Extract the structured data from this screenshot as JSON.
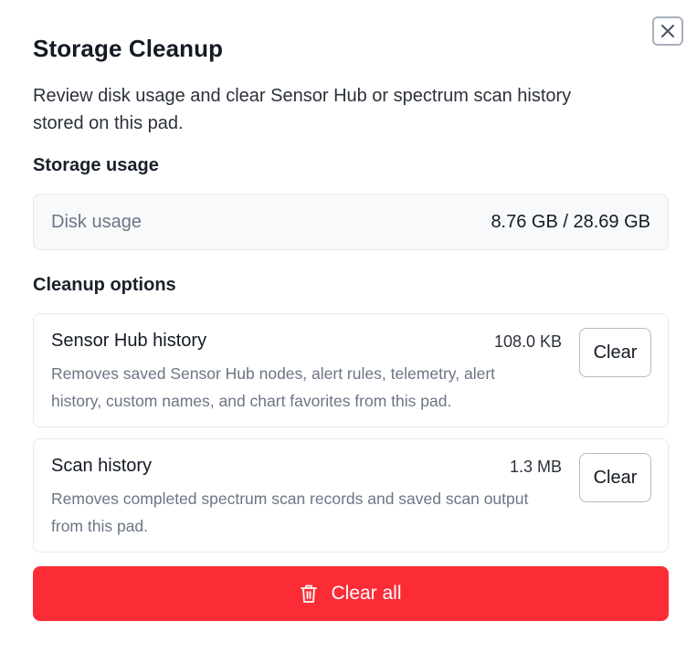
{
  "dialog": {
    "title": "Storage Cleanup",
    "description": "Review disk usage and clear Sensor Hub or spectrum scan history stored on this pad.",
    "close_icon": "close-icon"
  },
  "storage": {
    "section_label": "Storage usage",
    "disk_label": "Disk usage",
    "disk_value": "8.76 GB / 28.69 GB"
  },
  "cleanup": {
    "section_label": "Cleanup options",
    "options": [
      {
        "title": "Sensor Hub history",
        "size": "108.0 KB",
        "description": "Removes saved Sensor Hub nodes, alert rules, telemetry, alert history, custom names, and chart favorites from this pad.",
        "button_label": "Clear"
      },
      {
        "title": "Scan history",
        "size": "1.3 MB",
        "description": "Removes completed spectrum scan records and saved scan output from this pad.",
        "button_label": "Clear"
      }
    ]
  },
  "actions": {
    "clear_all_label": "Clear all",
    "clear_all_icon": "trash-icon",
    "clear_all_color": "#fb2c36"
  }
}
